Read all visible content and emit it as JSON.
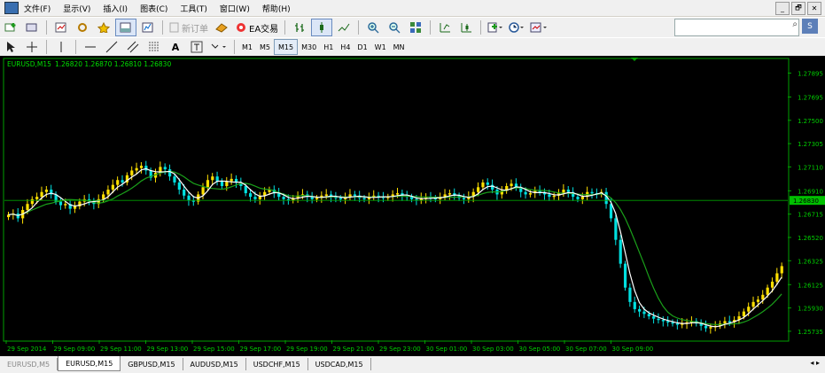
{
  "menu": [
    "文件(F)",
    "显示(V)",
    "插入(I)",
    "图表(C)",
    "工具(T)",
    "窗口(W)",
    "帮助(H)"
  ],
  "window_buttons": [
    "_",
    "🗗",
    "✕"
  ],
  "toolbar": {
    "new_order": "新订单",
    "ea_trading": "EA交易"
  },
  "timeframes": [
    "M1",
    "M5",
    "M15",
    "M30",
    "H1",
    "H4",
    "D1",
    "W1",
    "MN"
  ],
  "active_timeframe": "M15",
  "search": {
    "placeholder": ""
  },
  "chart_data": {
    "type": "candlestick",
    "symbol_label": "EURUSD,M15",
    "ohlc_label": "1.26820 1.26870 1.26810 1.26830",
    "current_price": "1.26830",
    "price_ticks": [
      "1.27895",
      "1.27695",
      "1.27500",
      "1.27305",
      "1.27110",
      "1.26910",
      "1.26715",
      "1.26520",
      "1.26325",
      "1.26125",
      "1.25930",
      "1.25735"
    ],
    "time_ticks": [
      "29 Sep 2014",
      "29 Sep 09:00",
      "29 Sep 11:00",
      "29 Sep 13:00",
      "29 Sep 15:00",
      "29 Sep 17:00",
      "29 Sep 19:00",
      "29 Sep 21:00",
      "29 Sep 23:00",
      "30 Sep 01:00",
      "30 Sep 03:00",
      "30 Sep 05:00",
      "30 Sep 07:00",
      "30 Sep 09:00"
    ],
    "y_range": [
      1.2566,
      1.2801
    ],
    "closes": [
      1.2671,
      1.2672,
      1.2668,
      1.2675,
      1.268,
      1.2684,
      1.2686,
      1.269,
      1.2692,
      1.2688,
      1.2682,
      1.2679,
      1.268,
      1.2676,
      1.2678,
      1.2682,
      1.2684,
      1.2682,
      1.268,
      1.2684,
      1.2688,
      1.2692,
      1.2696,
      1.27,
      1.2698,
      1.2704,
      1.2708,
      1.271,
      1.2712,
      1.2708,
      1.2702,
      1.2706,
      1.2711,
      1.2709,
      1.2703,
      1.2698,
      1.2692,
      1.2687,
      1.2683,
      1.2682,
      1.2688,
      1.2694,
      1.27,
      1.2703,
      1.2699,
      1.2695,
      1.2699,
      1.2701,
      1.2698,
      1.2695,
      1.2689,
      1.2686,
      1.2684,
      1.2687,
      1.269,
      1.2692,
      1.2689,
      1.2686,
      1.2684,
      1.2683,
      1.2685,
      1.2687,
      1.2688,
      1.2686,
      1.2684,
      1.2685,
      1.2687,
      1.2688,
      1.2686,
      1.2685,
      1.2684,
      1.2686,
      1.2688,
      1.2687,
      1.2685,
      1.2684,
      1.2686,
      1.2687,
      1.2686,
      1.2685,
      1.2686,
      1.2688,
      1.2689,
      1.2687,
      1.2686,
      1.2684,
      1.2683,
      1.2685,
      1.2686,
      1.2685,
      1.2684,
      1.2686,
      1.2688,
      1.2689,
      1.2687,
      1.2685,
      1.2684,
      1.2686,
      1.269,
      1.2694,
      1.2698,
      1.2696,
      1.2692,
      1.2688,
      1.2691,
      1.2695,
      1.2697,
      1.2694,
      1.269,
      1.2688,
      1.2689,
      1.2691,
      1.269,
      1.2688,
      1.2686,
      1.2687,
      1.2689,
      1.2692,
      1.269,
      1.2686,
      1.2684,
      1.2686,
      1.269,
      1.2689,
      1.2688,
      1.269,
      1.268,
      1.2668,
      1.265,
      1.263,
      1.261,
      1.2598,
      1.2592,
      1.259,
      1.2588,
      1.2586,
      1.2584,
      1.2583,
      1.2582,
      1.2581,
      1.258,
      1.2579,
      1.258,
      1.2581,
      1.2582,
      1.258,
      1.2578,
      1.2576,
      1.2577,
      1.2578,
      1.258,
      1.2582,
      1.2581,
      1.2583,
      1.2586,
      1.259,
      1.2594,
      1.2598,
      1.26,
      1.2604,
      1.261,
      1.2615,
      1.2622,
      1.2628
    ]
  },
  "tabs": [
    "EURUSD,M5",
    "EURUSD,M15",
    "GBPUSD,M15",
    "AUDUSD,M15",
    "USDCHF,M15",
    "USDCAD,M15"
  ],
  "active_tab": 1
}
